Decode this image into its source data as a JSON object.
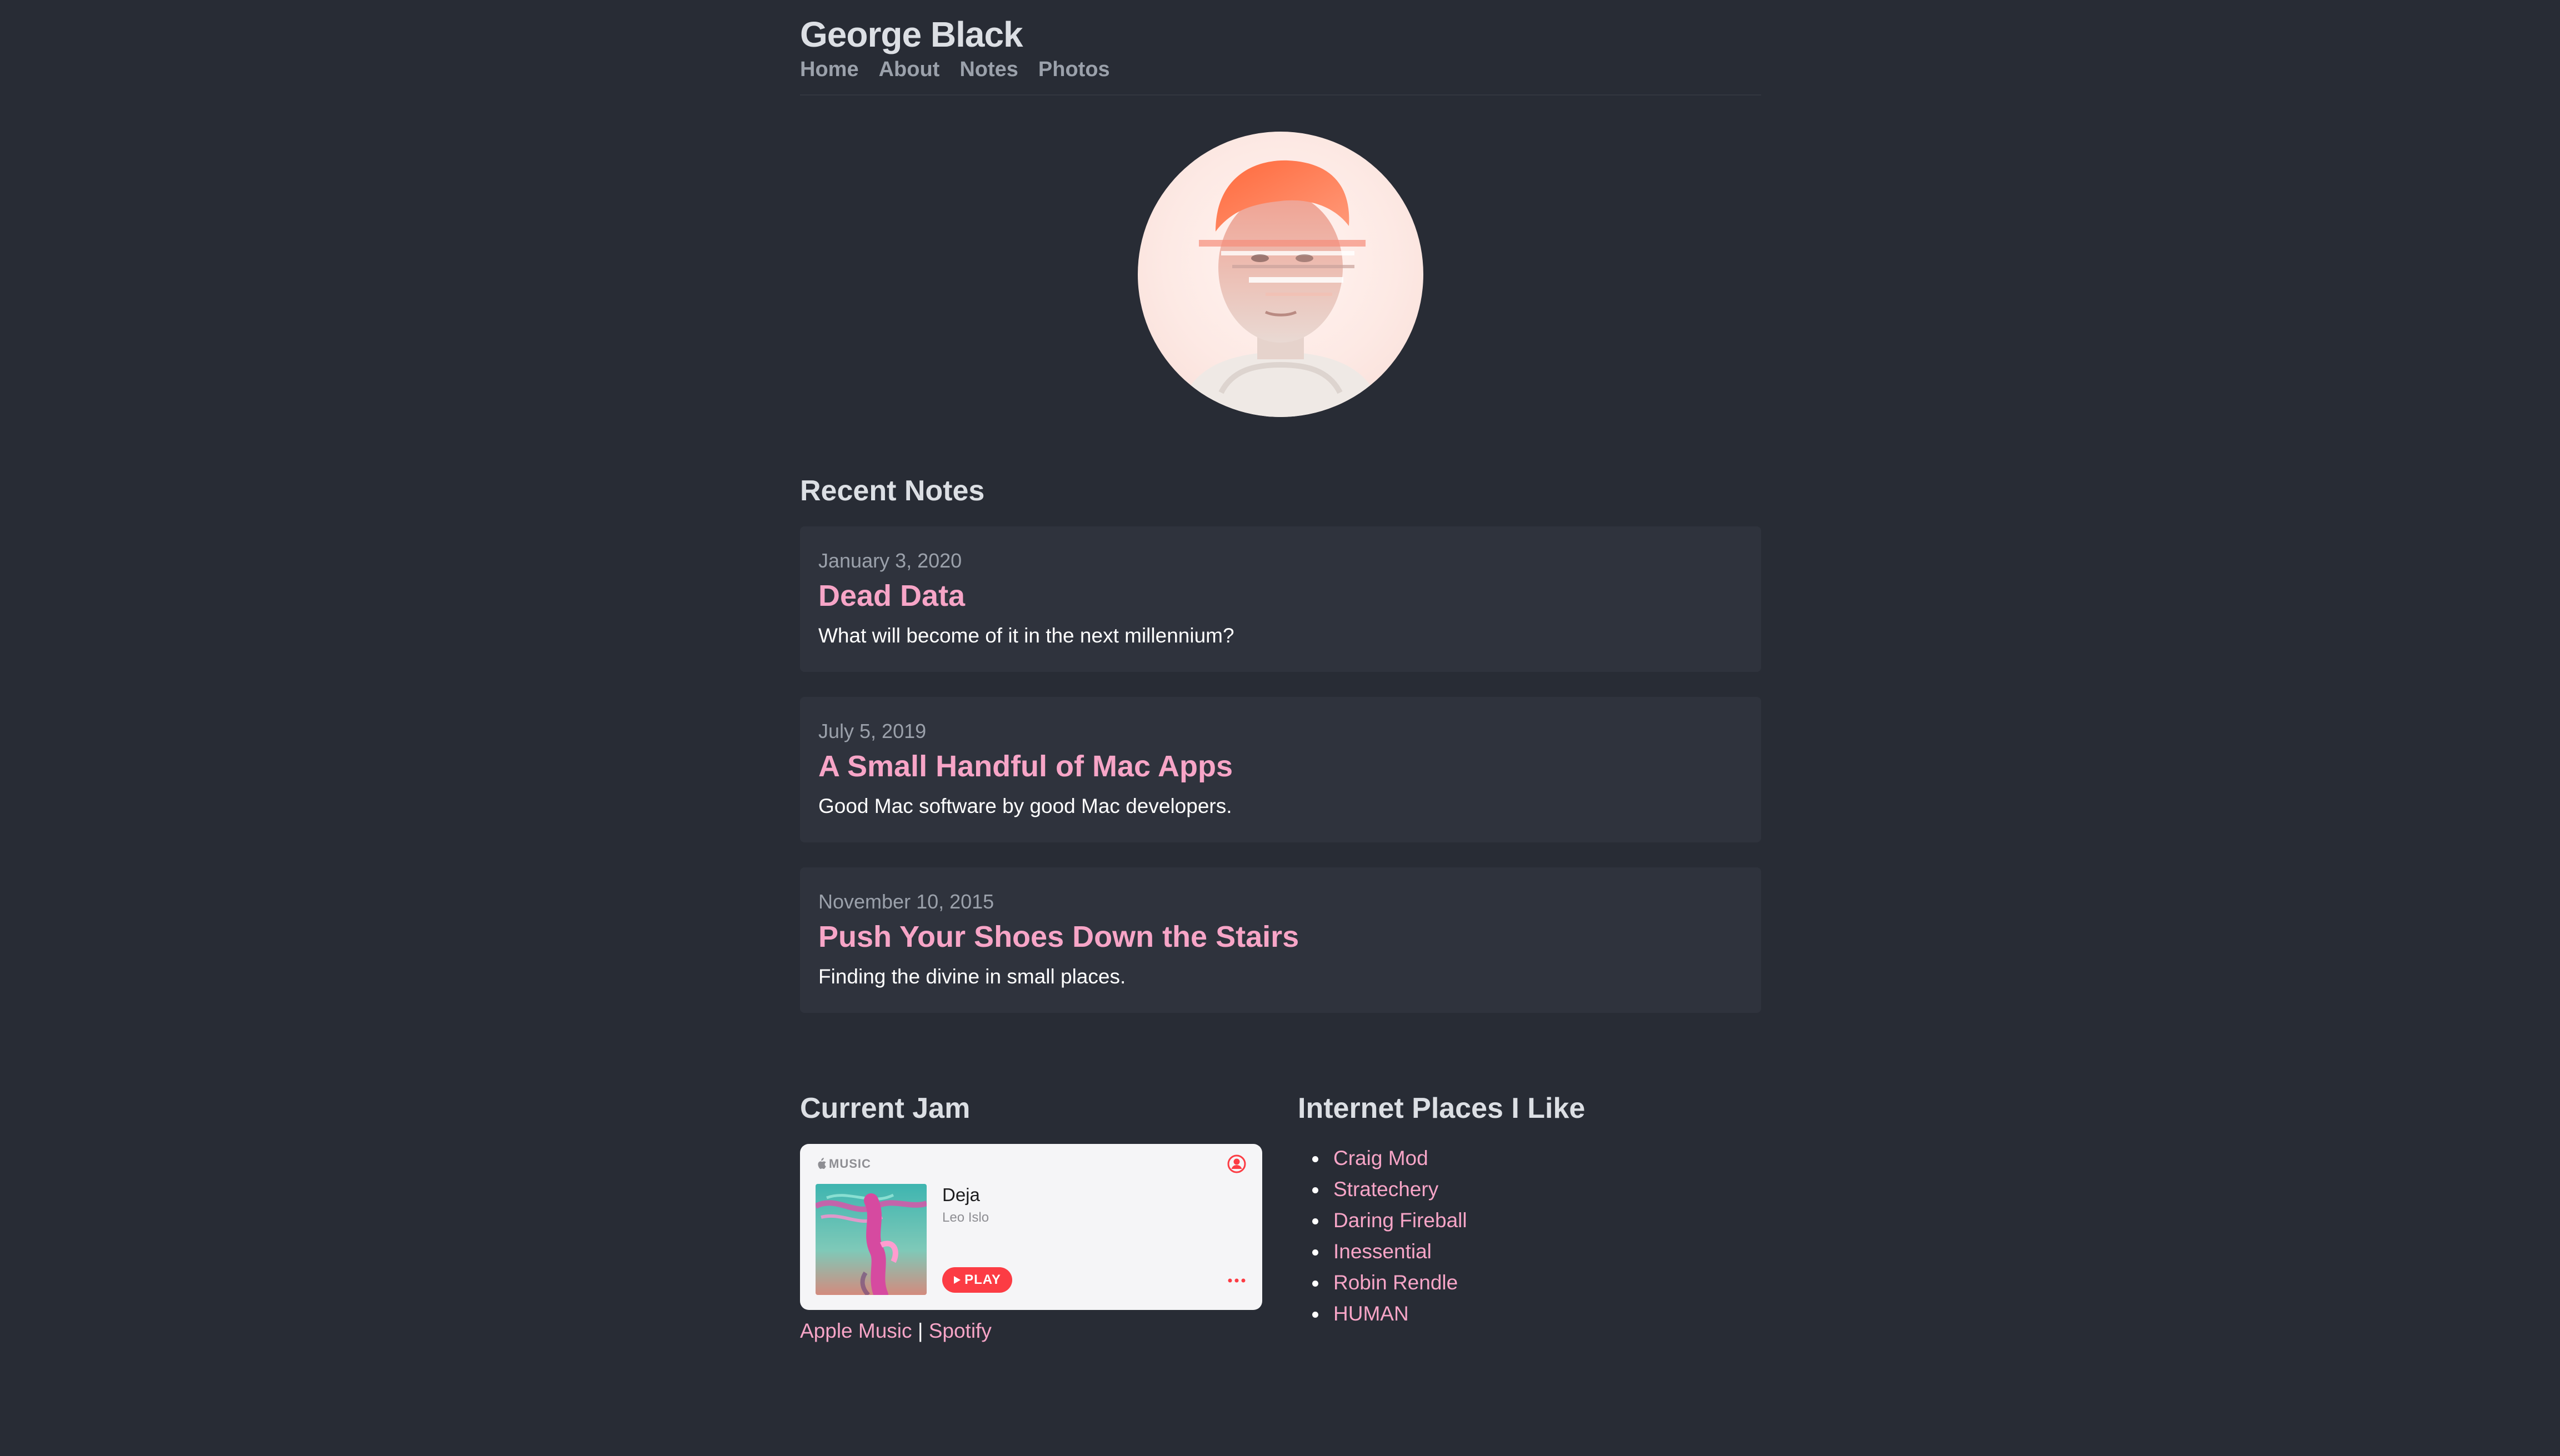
{
  "header": {
    "site_title": "George Black",
    "nav": [
      "Home",
      "About",
      "Notes",
      "Photos"
    ]
  },
  "recent_notes": {
    "heading": "Recent Notes",
    "items": [
      {
        "date": "January 3, 2020",
        "title": "Dead Data",
        "description": "What will become of it in the next millennium?"
      },
      {
        "date": "July 5, 2019",
        "title": "A Small Handful of Mac Apps",
        "description": "Good Mac software by good Mac developers."
      },
      {
        "date": "November 10, 2015",
        "title": "Push Your Shoes Down the Stairs",
        "description": "Finding the divine in small places."
      }
    ]
  },
  "current_jam": {
    "heading": "Current Jam",
    "player": {
      "brand": "MUSIC",
      "song": "Deja",
      "artist": "Leo Islo",
      "play_label": "PLAY"
    },
    "links": [
      "Apple Music",
      "Spotify"
    ],
    "separator": "|"
  },
  "places": {
    "heading": "Internet Places I Like",
    "items": [
      "Craig Mod",
      "Stratechery",
      "Daring Fireball",
      "Inessential",
      "Robin Rendle",
      "HUMAN"
    ]
  },
  "colors": {
    "background": "#282c35",
    "card": "#2f333d",
    "accent_pink": "#f7a5c7",
    "heading": "#dcdfe4",
    "muted": "#9ba1ab",
    "apple_music_red": "#fc3c44"
  },
  "icons": {
    "apple_logo": "apple-icon",
    "user": "user-icon",
    "play": "play-icon",
    "more": "more-icon"
  }
}
